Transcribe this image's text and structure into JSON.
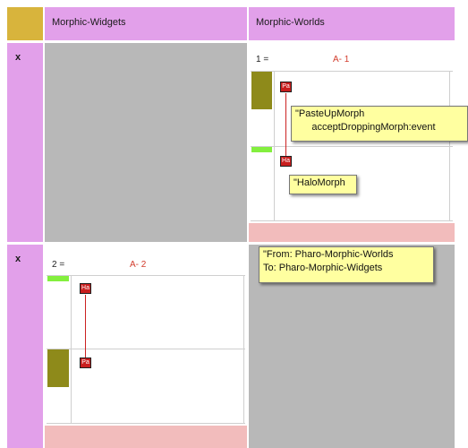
{
  "columns": {
    "widgets_header": "Morphic-Widgets",
    "worlds_header": "Morphic-Worlds"
  },
  "rows": [
    {
      "marker": "x"
    },
    {
      "marker": "x"
    }
  ],
  "cell1": {
    "index": "1 =",
    "name": "A- 1",
    "chip_top": "Pa",
    "chip_bottom": "Ha"
  },
  "cell2": {
    "index": "2 =",
    "name": "A- 2",
    "chip_top": "Ha",
    "chip_bottom": "Pa"
  },
  "tooltips": {
    "pasteup": "\"PasteUpMorph\n      acceptDroppingMorph:event",
    "halo": "\"HaloMorph",
    "dependency": "\"From: Pharo-Morphic-Worlds\nTo: Pharo-Morphic-Widgets"
  },
  "colors": {
    "header": "#e2a0ea",
    "corner": "#d8b43c",
    "cell_name": "#d23c2c",
    "olive_block": "#8e8a1a",
    "green_bar": "#83ef3e",
    "footer_pink": "#f2bcbc",
    "tooltip_bg": "#ffffa0"
  }
}
